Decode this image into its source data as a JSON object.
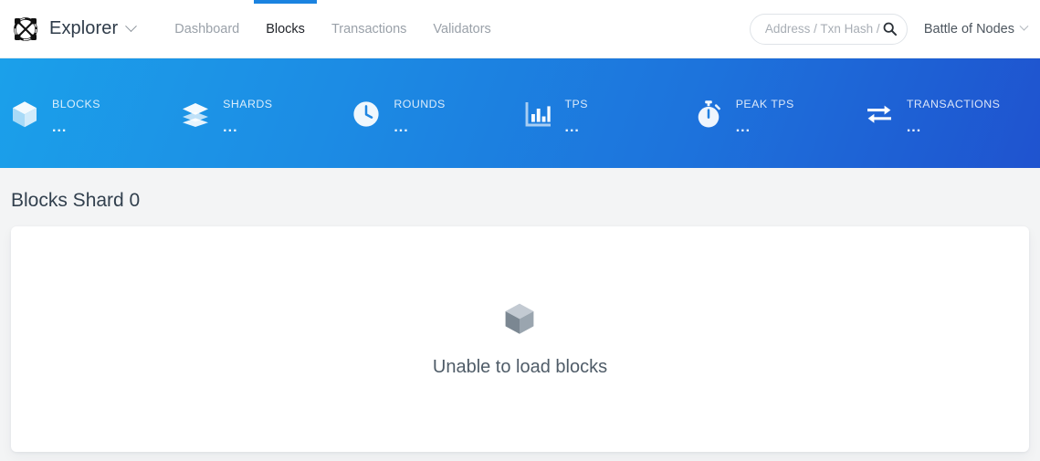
{
  "header": {
    "brand": {
      "name": "Explorer",
      "logo_icon": "elrond-logo-icon",
      "caret_icon": "chevron-down-icon"
    },
    "nav": [
      {
        "label": "Dashboard",
        "active": false
      },
      {
        "label": "Blocks",
        "active": true
      },
      {
        "label": "Transactions",
        "active": false
      },
      {
        "label": "Validators",
        "active": false
      }
    ],
    "search": {
      "placeholder": "Address / Txn Hash / E",
      "value": "",
      "icon": "search-icon"
    },
    "network": {
      "label": "Battle of Nodes",
      "caret_icon": "chevron-down-icon"
    },
    "accent_color": "#1b83e0"
  },
  "stats": {
    "gradient_from": "#1ba0ea",
    "gradient_to": "#1f53cf",
    "items": [
      {
        "label": "BLOCKS",
        "value": "...",
        "icon": "cube-icon"
      },
      {
        "label": "SHARDS",
        "value": "...",
        "icon": "layers-icon"
      },
      {
        "label": "ROUNDS",
        "value": "...",
        "icon": "clock-icon"
      },
      {
        "label": "TPS",
        "value": "...",
        "icon": "bar-chart-icon"
      },
      {
        "label": "PEAK TPS",
        "value": "...",
        "icon": "stopwatch-icon"
      },
      {
        "label": "TRANSACTIONS",
        "value": "...",
        "icon": "exchange-arrows-icon"
      }
    ]
  },
  "main": {
    "page_title": "Blocks Shard 0",
    "empty_state": {
      "icon": "cube-icon",
      "message": "Unable to load blocks"
    }
  }
}
